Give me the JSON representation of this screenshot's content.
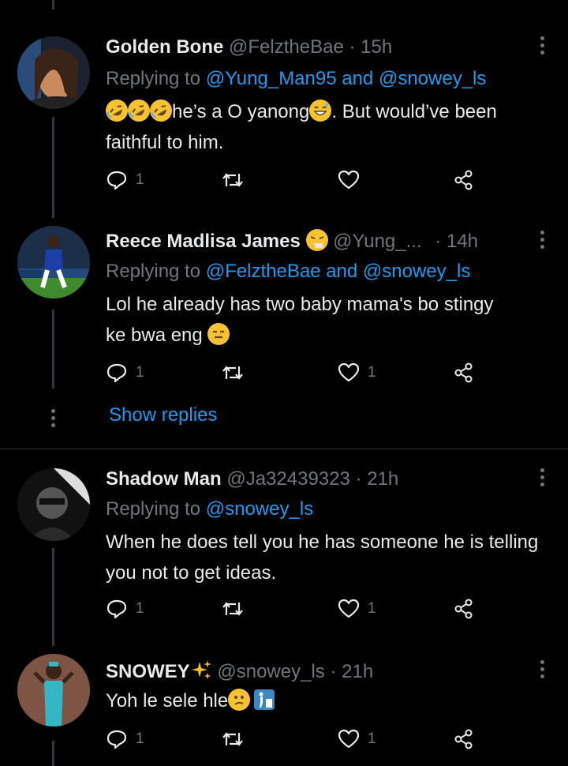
{
  "tweets": [
    {
      "name": "Golden Bone",
      "handle": "@FelztheBae",
      "sep": "·",
      "time": "15h",
      "replying_prefix": "Replying to",
      "replying_to": "@Yung_Man95 and @snowey_ls",
      "text_pre_emojis": [
        "rolling-on-floor-laughing",
        "rolling-on-floor-laughing",
        "rolling-on-floor-laughing"
      ],
      "text_a": "he’s a O yanong",
      "text_emoji_mid": "grinning-sweat",
      "text_b": ". But would’ve been faithful to him.",
      "reply_count": "1",
      "like_count": ""
    },
    {
      "name": "Reece Madlisa James",
      "name_emoji": "sneezing-face",
      "handle": "@Yung_...",
      "sep": "·",
      "time": "14h",
      "replying_prefix": "Replying to",
      "replying_to": "@FelztheBae and @snowey_ls",
      "text": "Lol he already has two baby mama's bo stingy ke bwa eng",
      "text_emoji": "expressionless-face",
      "reply_count": "1",
      "like_count": "1"
    },
    {
      "name": "Shadow Man",
      "handle": "@Ja32439323",
      "sep": "·",
      "time": "21h",
      "replying_prefix": "Replying to",
      "replying_to": "@snowey_ls",
      "text": "When he does tell you he has someone he is telling you not to get ideas.",
      "reply_count": "1",
      "like_count": "1"
    },
    {
      "name": "SNOWEY",
      "name_emoji": "sparkles",
      "handle": "@snowey_ls",
      "sep": "·",
      "time": "21h",
      "text": "Yoh le sele hle",
      "text_emojis": [
        "confused-face",
        "put-litter-in-its-place"
      ],
      "reply_count": "1",
      "like_count": "1"
    }
  ],
  "show_replies": "Show replies",
  "colors": {
    "background": "#000000",
    "text": "#e7e9ea",
    "muted": "#71767b",
    "link": "#1d9bf0",
    "divider": "#2f3336"
  }
}
